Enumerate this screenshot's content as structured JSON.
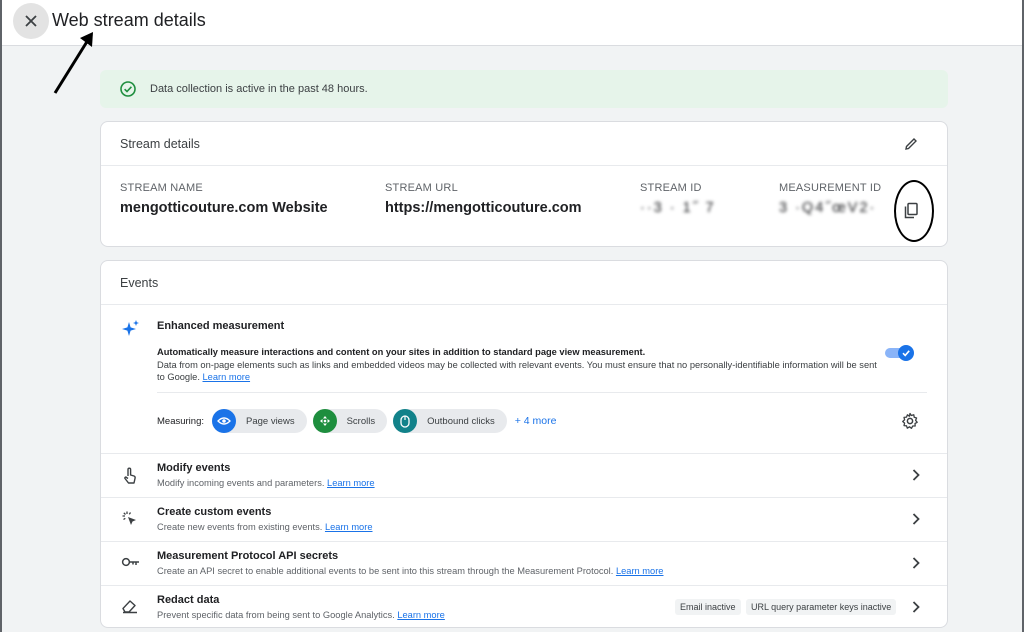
{
  "header": {
    "title": "Web stream details",
    "close_icon": "close-icon"
  },
  "banner": {
    "text": "Data collection is active in the past 48 hours.",
    "color": "#e6f4ea",
    "icon": "check-circle-icon"
  },
  "stream_details": {
    "heading": "Stream details",
    "fields": [
      {
        "label": "STREAM NAME",
        "value": "mengotticouture.com Website"
      },
      {
        "label": "STREAM URL",
        "value": "https://mengotticouture.com"
      },
      {
        "label": "STREAM ID",
        "value": "··3 · 1˝ 7"
      },
      {
        "label": "MEASUREMENT ID",
        "value": "3 ·Q4˝œV2·"
      }
    ]
  },
  "events": {
    "heading": "Events",
    "enhanced": {
      "title": "Enhanced measurement",
      "desc_bold": "Automatically measure interactions and content on your sites in addition to standard page view measurement.",
      "desc_rest": "Data from on-page elements such as links and embedded videos may be collected with relevant events. You must ensure that no personally-identifiable information will be sent to Google.",
      "learn_more": "Learn more",
      "toggle_on": true,
      "measuring_label": "Measuring:",
      "chips": [
        {
          "label": "Page views",
          "icon": "eye-icon",
          "color": "#1a73e8"
        },
        {
          "label": "Scrolls",
          "icon": "scroll-icon",
          "color": "#1e8e3e"
        },
        {
          "label": "Outbound clicks",
          "icon": "mouse-icon",
          "color": "#12828a"
        }
      ],
      "more": "+ 4 more"
    },
    "rows": [
      {
        "title": "Modify events",
        "desc": "Modify incoming events and parameters.",
        "link": "Learn more",
        "icon": "touch-icon"
      },
      {
        "title": "Create custom events",
        "desc": "Create new events from existing events.",
        "link": "Learn more",
        "icon": "sparkle-click-icon"
      },
      {
        "title": "Measurement Protocol API secrets",
        "desc": "Create an API secret to enable additional events to be sent into this stream through the Measurement Protocol.",
        "link": "Learn more",
        "icon": "key-icon"
      },
      {
        "title": "Redact data",
        "desc": "Prevent specific data from being sent to Google Analytics.",
        "link": "Learn more",
        "icon": "eraser-icon",
        "tags": [
          "Email inactive",
          "URL query parameter keys inactive"
        ]
      }
    ]
  }
}
